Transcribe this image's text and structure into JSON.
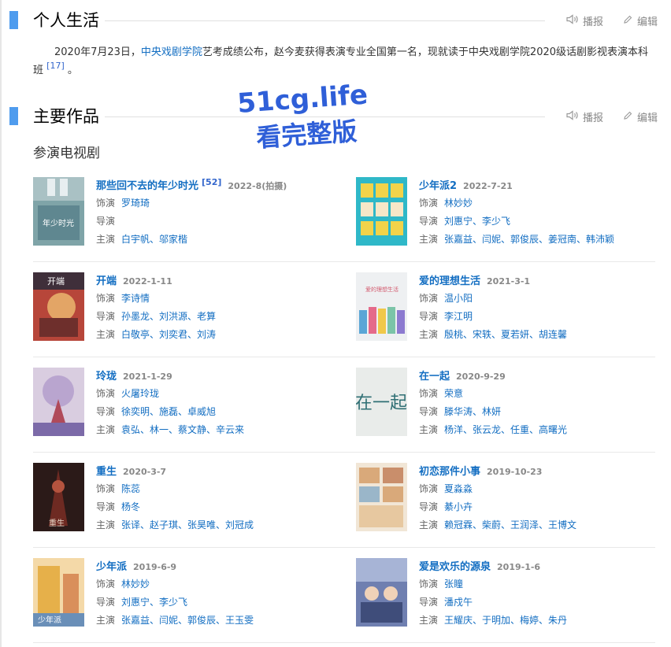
{
  "personal": {
    "title": "个人生活",
    "read_label": "播报",
    "edit_label": "编辑",
    "para_before": "2020年7月23日，",
    "para_link": "中央戏剧学院",
    "para_after": "艺考成绩公布，赵今麦获得表演专业全国第一名，现就读于中央戏剧学院2020级话剧影视表演本科班",
    "para_ref": "[17]",
    "para_end": " 。"
  },
  "works_section": {
    "title": "主要作品",
    "read_label": "播报",
    "edit_label": "编辑",
    "subhead": "参演电视剧"
  },
  "labels": {
    "role": "饰演",
    "director": "导演",
    "cast": "主演"
  },
  "works": [
    {
      "title": "那些回不去的年少时光",
      "ref": "[52]",
      "date": "2022-8(拍摄)",
      "role": "罗琦琦",
      "director": "",
      "cast": "白宇帆、邬家楷"
    },
    {
      "title": "少年派2",
      "ref": "",
      "date": "2022-7-21",
      "role": "林妙妙",
      "director": "刘惠宁、李少飞",
      "cast": "张嘉益、闫妮、郭俊辰、姜冠南、韩沛颖"
    },
    {
      "title": "开端",
      "ref": "",
      "date": "2022-1-11",
      "role": "李诗情",
      "director": "孙墨龙、刘洪源、老算",
      "cast": "白敬亭、刘奕君、刘涛"
    },
    {
      "title": "爱的理想生活",
      "ref": "",
      "date": "2021-3-1",
      "role": "温小阳",
      "director": "李江明",
      "cast": "殷桃、宋轶、夏若妍、胡连馨"
    },
    {
      "title": "玲珑",
      "ref": "",
      "date": "2021-1-29",
      "role": "火屠玲珑",
      "director": "徐奕明、施磊、卓威旭",
      "cast": "袁弘、林一、蔡文静、辛云来"
    },
    {
      "title": "在一起",
      "ref": "",
      "date": "2020-9-29",
      "role": "荣意",
      "director": "滕华涛、林妍",
      "cast": "杨洋、张云龙、任重、高曙光"
    },
    {
      "title": "重生",
      "ref": "",
      "date": "2020-3-7",
      "role": "陈蕊",
      "director": "杨冬",
      "cast": "张译、赵子琪、张昊唯、刘冠成"
    },
    {
      "title": "初恋那件小事",
      "ref": "",
      "date": "2019-10-23",
      "role": "夏淼淼",
      "director": "綦小卉",
      "cast": "赖冠霖、柴蔚、王润泽、王博文"
    },
    {
      "title": "少年派",
      "ref": "",
      "date": "2019-6-9",
      "role": "林妙妙",
      "director": "刘惠宁、李少飞",
      "cast": "张嘉益、闫妮、郭俊辰、王玉雯"
    },
    {
      "title": "爱是欢乐的源泉",
      "ref": "",
      "date": "2019-1-6",
      "role": "张瞳",
      "director": "潘戍午",
      "cast": "王耀庆、于明加、梅婷、朱丹"
    }
  ],
  "poster_texts": {
    "p0": "年少时光",
    "p2": "开端",
    "p5": "在一起",
    "p6": "重生",
    "p8": "少年派"
  },
  "watermark": {
    "line1": "51cg.life",
    "line2": "看完整版"
  },
  "colors": {
    "accent": "#4f9cee",
    "link": "#136ec2",
    "text": "#333333",
    "muted": "#888888"
  },
  "icons": {
    "read": "speaker-icon",
    "edit": "pencil-icon"
  }
}
